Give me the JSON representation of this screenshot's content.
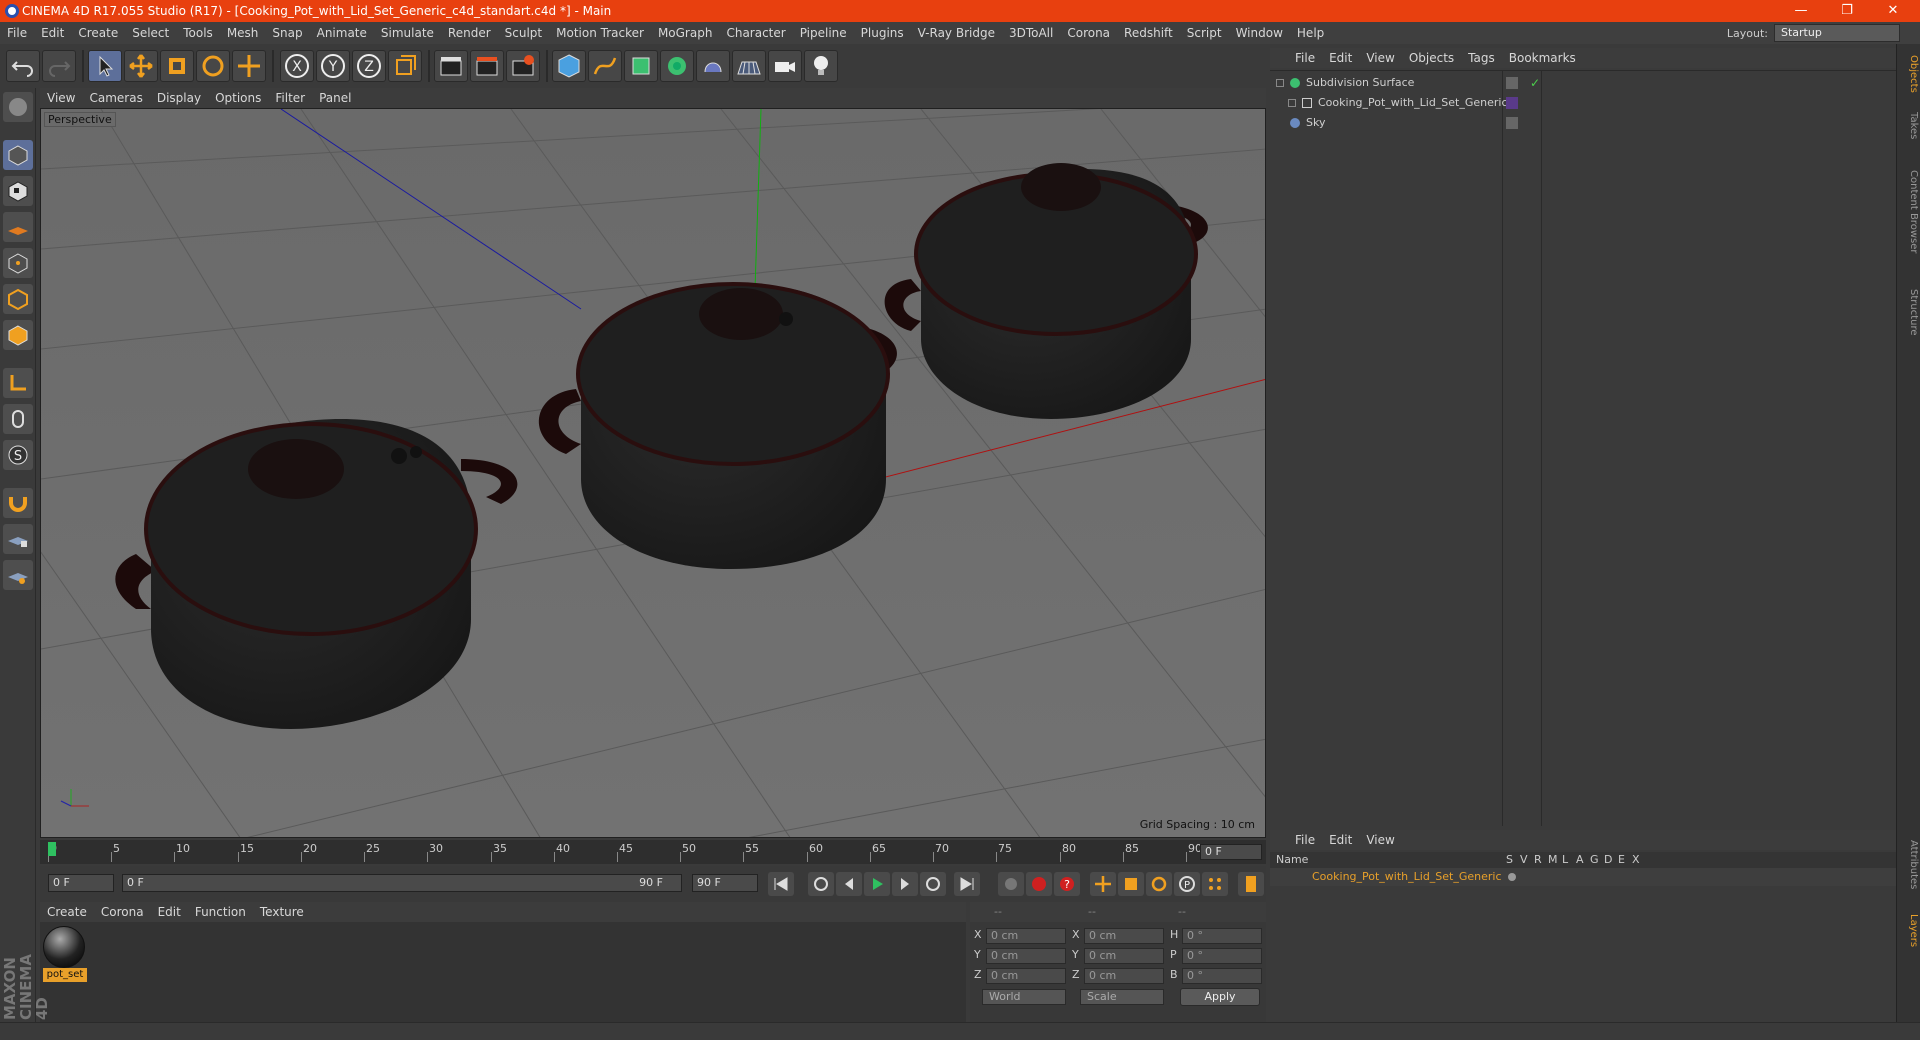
{
  "title": "CINEMA 4D R17.055 Studio (R17) - [Cooking_Pot_with_Lid_Set_Generic_c4d_standart.c4d *] - Main",
  "menu": [
    "File",
    "Edit",
    "Create",
    "Select",
    "Tools",
    "Mesh",
    "Snap",
    "Animate",
    "Simulate",
    "Render",
    "Sculpt",
    "Motion Tracker",
    "MoGraph",
    "Character",
    "Pipeline",
    "Plugins",
    "V-Ray Bridge",
    "3DToAll",
    "Corona",
    "Redshift",
    "Script",
    "Window",
    "Help"
  ],
  "layout": {
    "label": "Layout:",
    "value": "Startup"
  },
  "viewport": {
    "menu": [
      "View",
      "Cameras",
      "Display",
      "Options",
      "Filter",
      "Panel"
    ],
    "label": "Perspective",
    "grid": "Grid Spacing : 10 cm"
  },
  "objects": {
    "menu": [
      "File",
      "Edit",
      "View",
      "Objects",
      "Tags",
      "Bookmarks"
    ],
    "items": [
      "Subdivision Surface",
      "Cooking_Pot_with_Lid_Set_Generic",
      "Sky"
    ]
  },
  "layers": {
    "menu": [
      "File",
      "Edit",
      "View"
    ],
    "head": {
      "name": "Name",
      "cols": [
        "S",
        "V",
        "R",
        "M",
        "L",
        "A",
        "G",
        "D",
        "E",
        "X"
      ]
    },
    "row": "Cooking_Pot_with_Lid_Set_Generic"
  },
  "timeline": {
    "ticks": [
      "0",
      "5",
      "10",
      "15",
      "20",
      "25",
      "30",
      "35",
      "40",
      "45",
      "50",
      "55",
      "60",
      "65",
      "70",
      "75",
      "80",
      "85",
      "90"
    ],
    "current": "0 F"
  },
  "transport": {
    "start": "0 F",
    "range_start": "0 F",
    "range_end": "90 F",
    "end": "90 F"
  },
  "materials": {
    "menu": [
      "Create",
      "Corona",
      "Edit",
      "Function",
      "Texture"
    ],
    "name": "pot_set"
  },
  "coords": {
    "head": [
      "--",
      "--",
      "--"
    ],
    "rows": [
      {
        "a": "X",
        "av": "0 cm",
        "b": "X",
        "bv": "0 cm",
        "c": "H",
        "cv": "0 °"
      },
      {
        "a": "Y",
        "av": "0 cm",
        "b": "Y",
        "bv": "0 cm",
        "c": "P",
        "cv": "0 °"
      },
      {
        "a": "Z",
        "av": "0 cm",
        "b": "Z",
        "bv": "0 cm",
        "c": "B",
        "cv": "0 °"
      }
    ],
    "world": "World",
    "scale": "Scale",
    "apply": "Apply"
  },
  "sidetabs": [
    "Objects",
    "Takes",
    "Content Browser",
    "Structure"
  ],
  "sidetabs2": [
    "Attributes",
    "Layers"
  ],
  "brand": "MAXON CINEMA 4D",
  "colors": {
    "titlebar": "#e8400f",
    "accent": "#e8a02a",
    "viewport": "#6e6e6e"
  }
}
